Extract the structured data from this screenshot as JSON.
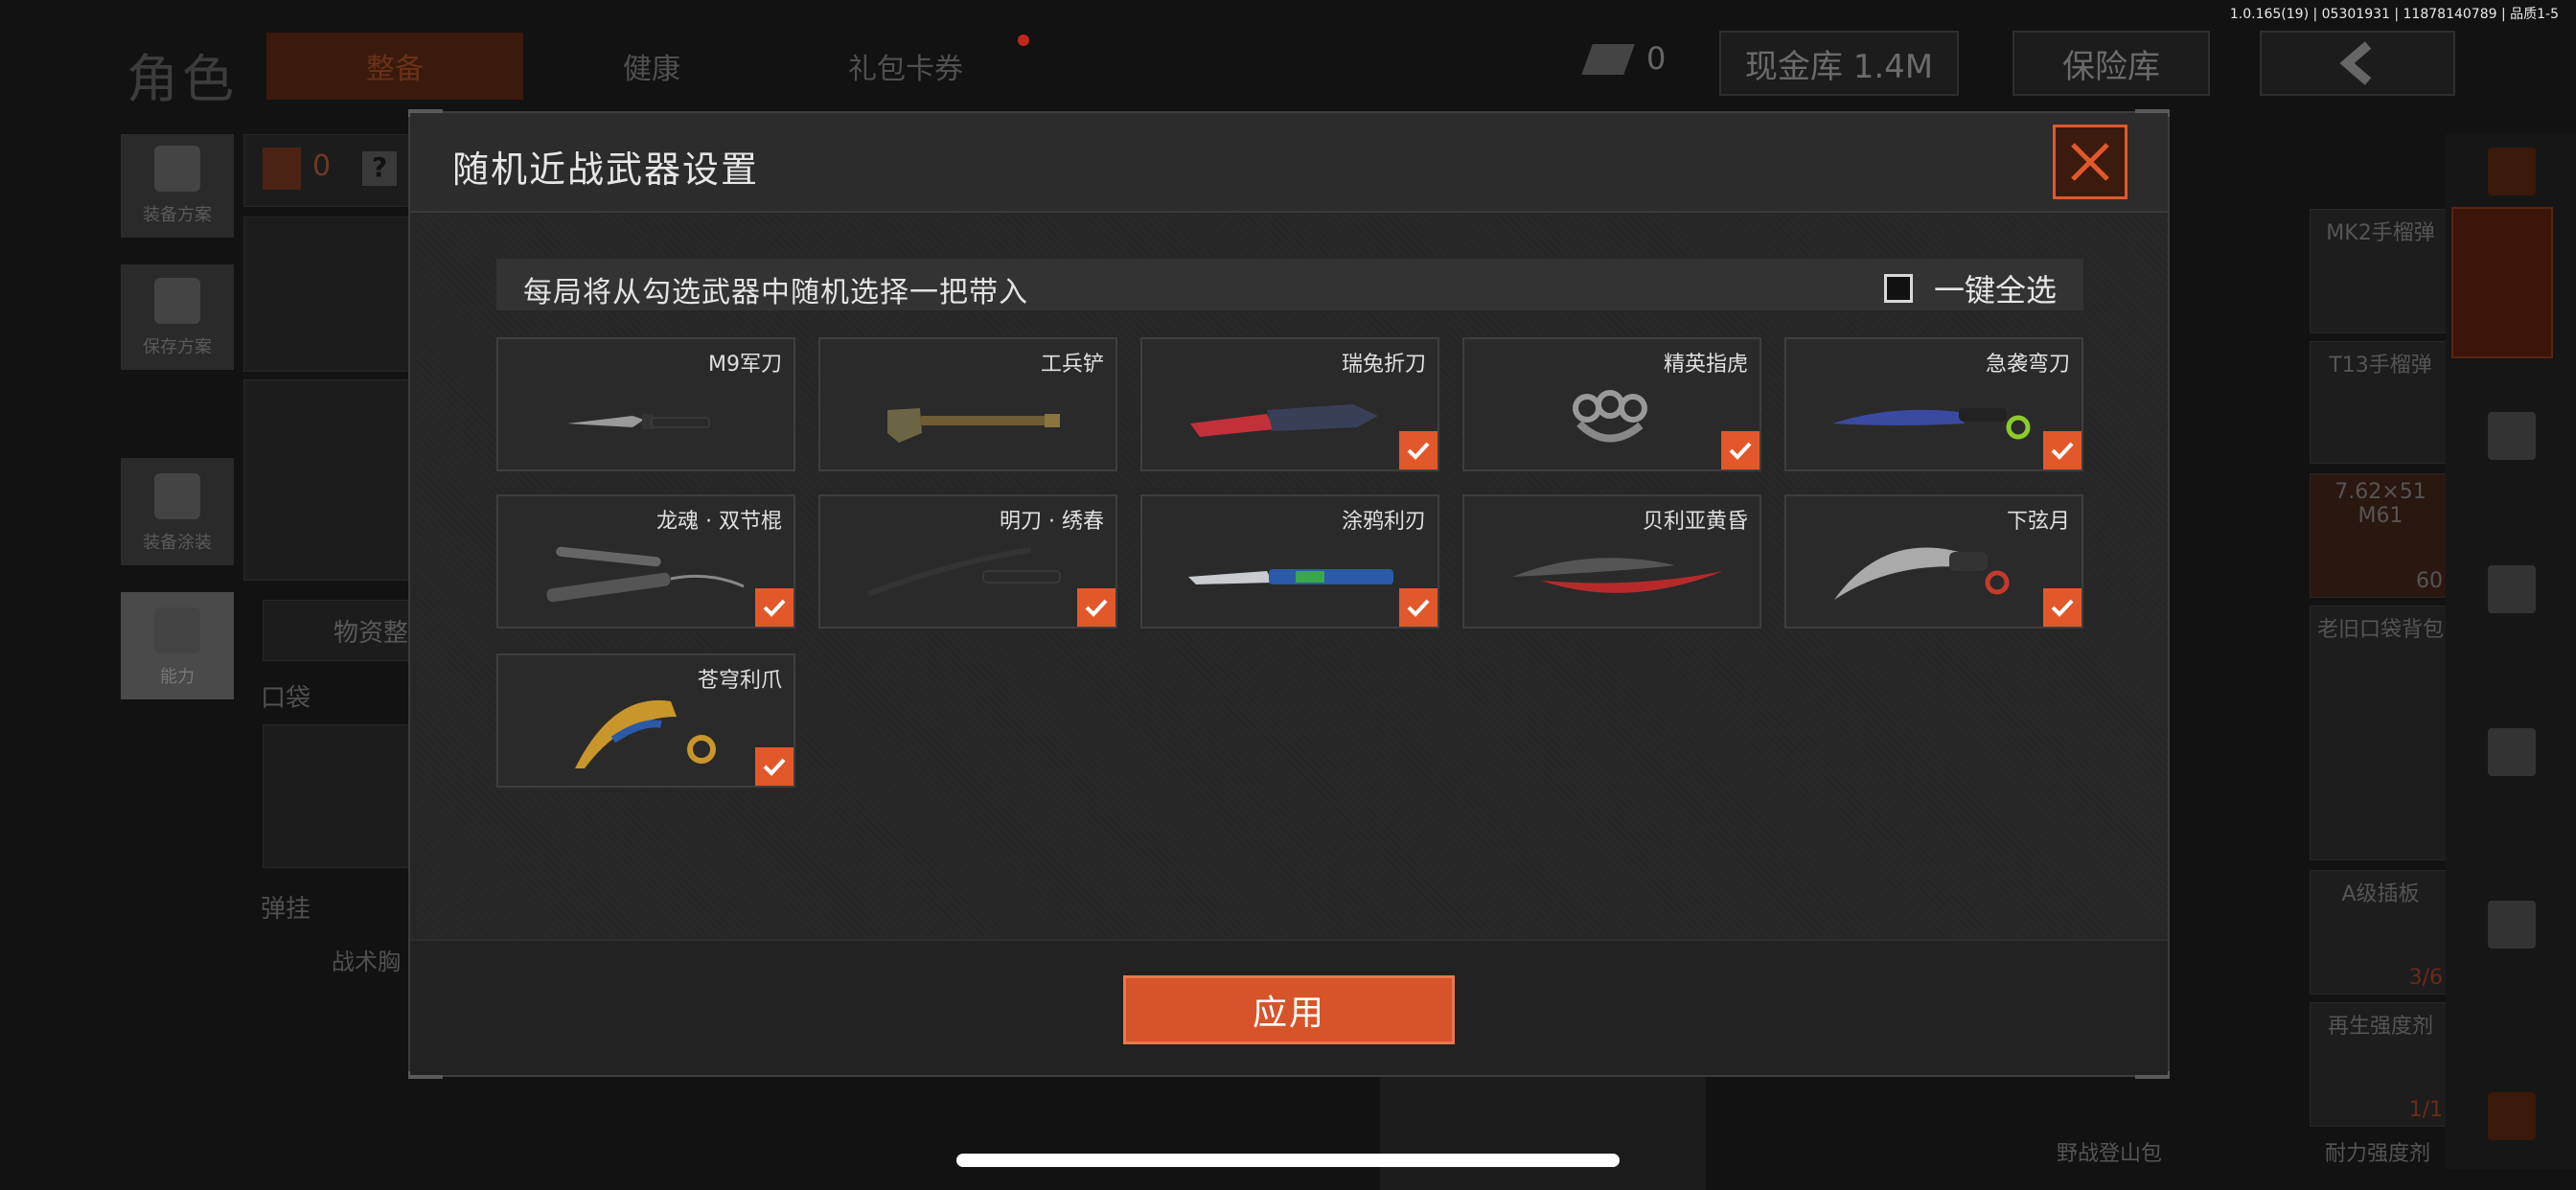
{
  "status_bar": {
    "version": "1.0.165(19) | 05301931 | 11878140789 | 品质1-5"
  },
  "background": {
    "title": "角色",
    "tabs": [
      {
        "label": "整备",
        "active": true
      },
      {
        "label": "健康",
        "active": false
      },
      {
        "label": "礼包卡券",
        "active": false
      }
    ],
    "cash_count": "0",
    "cash_vault": "现金库 1.4M",
    "safe_box": "保险库",
    "side_buttons": [
      "装备方案",
      "保存方案",
      "装备涂装",
      "能力"
    ],
    "armor_count": "0",
    "armor_help": "?",
    "supply_tab": "物资整",
    "pocket_label": "口袋",
    "sling_label": "弹挂",
    "tactical_label": "战术胸",
    "right_items": [
      {
        "label": "MK2手榴弹"
      },
      {
        "label": "T13手榴弹"
      },
      {
        "label": "7.62×51 M61",
        "count": "60"
      },
      {
        "label": "老旧口袋背包"
      },
      {
        "label": "A级插板",
        "count": "3/6"
      },
      {
        "label": "再生强度剂",
        "count": "1/1"
      },
      {
        "label": "耐力强度剂"
      }
    ],
    "bottom_label": "野战登山包"
  },
  "modal": {
    "title": "随机近战武器设置",
    "description": "每局将从勾选武器中随机选择一把带入",
    "select_all_label": "一键全选",
    "select_all_checked": false,
    "apply_label": "应用",
    "accent_color": "#e2582b",
    "weapons": [
      {
        "name": "M9军刀",
        "checked": false
      },
      {
        "name": "工兵铲",
        "checked": false
      },
      {
        "name": "瑞兔折刀",
        "checked": true
      },
      {
        "name": "精英指虎",
        "checked": true
      },
      {
        "name": "急袭弯刀",
        "checked": true
      },
      {
        "name": "龙魂 · 双节棍",
        "checked": true
      },
      {
        "name": "明刀 · 绣春",
        "checked": true
      },
      {
        "name": "涂鸦利刃",
        "checked": true
      },
      {
        "name": "贝利亚黄昏",
        "checked": false
      },
      {
        "name": "下弦月",
        "checked": true
      },
      {
        "name": "苍穹利爪",
        "checked": true
      }
    ]
  }
}
